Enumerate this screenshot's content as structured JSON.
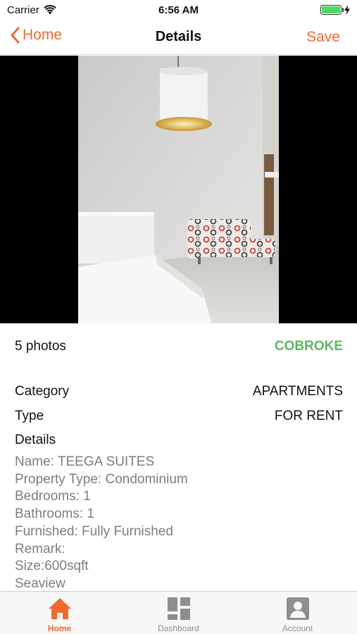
{
  "status_bar": {
    "carrier": "Carrier",
    "time": "6:56 AM"
  },
  "nav": {
    "back_label": "Home",
    "title": "Details",
    "save_label": "Save"
  },
  "photo": {
    "count_label": "5 photos",
    "cobroke_label": "COBROKE"
  },
  "info": {
    "category_label": "Category",
    "category_value": "APARTMENTS",
    "type_label": "Type",
    "type_value": "FOR RENT",
    "details_heading": "Details",
    "details_lines": [
      "Name: TEEGA SUITES",
      "Property Type: Condominium",
      "Bedrooms: 1",
      "Bathrooms: 1",
      "Furnished: Fully Furnished",
      "Remark:",
      "Size:600sqft",
      "Seaview"
    ]
  },
  "tab_bar": {
    "tabs": [
      {
        "label": "Home",
        "icon": "home-icon",
        "active": true
      },
      {
        "label": "Dashboard",
        "icon": "dashboard-icon",
        "active": false
      },
      {
        "label": "Account",
        "icon": "account-icon",
        "active": false
      }
    ]
  },
  "colors": {
    "accent": "#ef6a32",
    "cobroke": "#5cb85c",
    "details_text": "#7d7d7d"
  }
}
